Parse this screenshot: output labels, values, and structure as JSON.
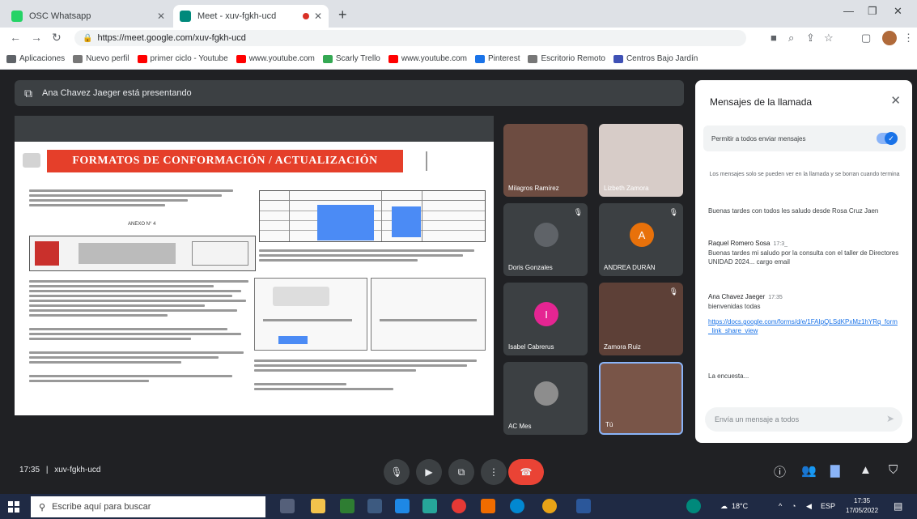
{
  "browser": {
    "tabs": [
      {
        "title": "OSC Whatsapp",
        "active": false
      },
      {
        "title": "Meet - xuv-fgkh-ucd",
        "active": true
      }
    ],
    "url": "https://meet.google.com/xuv-fgkh-ucd",
    "bookmarks": [
      "Aplicaciones",
      "Nuevo perfil",
      "primer ciclo - Youtube",
      "www.youtube.com",
      "Scarly Trello",
      "www.youtube.com",
      "Pinterest",
      "Escritorio Remoto",
      "Centros Bajo Jardín"
    ]
  },
  "meet": {
    "presenting_banner": "Ana Chavez Jaeger está presentando",
    "document": {
      "header_title": "FORMATOS DE CONFORMACIÓN / ACTUALIZACIÓN",
      "annex_label": "ANEXO N° 4"
    },
    "participants": [
      {
        "name": "Milagros Ramírez",
        "initial": "",
        "color": "#6d4c41"
      },
      {
        "name": "Lizbeth Zamora",
        "initial": "",
        "color": "#d7ccc8"
      },
      {
        "name": "Doris Gonzales",
        "initial": "",
        "color": "#3c4043"
      },
      {
        "name": "ANDREA DURÁN",
        "initial": "A",
        "color": "#e8710a"
      },
      {
        "name": "Isabel Cabrerus",
        "initial": "I",
        "color": "#e52592"
      },
      {
        "name": "Zamora Ruiz",
        "initial": "",
        "color": "#5d4037"
      },
      {
        "name": "AC Mes",
        "initial": "",
        "color": "#3c4043"
      },
      {
        "name": "Tú",
        "initial": "",
        "color": "#795548"
      }
    ],
    "meeting_time": "17:35",
    "meeting_code": "xuv-fgkh-ucd"
  },
  "chat": {
    "title": "Mensajes de la llamada",
    "toggle_label": "Permitir a todos enviar mensajes",
    "notice": "Los mensajes solo se pueden ver en la llamada y se borran cuando termina",
    "messages": [
      {
        "who": "",
        "time": "",
        "text": "Buenas tardes con todos les saludo desde Rosa Cruz Jaen"
      },
      {
        "who": "Raquel Romero Sosa",
        "time": "17:3_",
        "text": "Buenas tardes mi saludo por la consulta con el taller de Directores UNIDAD 2024... cargo email"
      },
      {
        "who": "Ana Chavez Jaeger",
        "time": "17:35",
        "text": "bienvenidas todas",
        "link": "https://docs.google.com/forms/d/e/1FAIpQLSdKPxMz1hYRq_form_link_share_view"
      },
      {
        "who": "",
        "time": "",
        "text": "La encuesta..."
      }
    ],
    "input_placeholder": "Envía un mensaje a todos"
  },
  "taskbar": {
    "search_placeholder": "Escribe aquí para buscar",
    "temp": "18°C",
    "time": "17:35",
    "date": "17/05/2022"
  }
}
